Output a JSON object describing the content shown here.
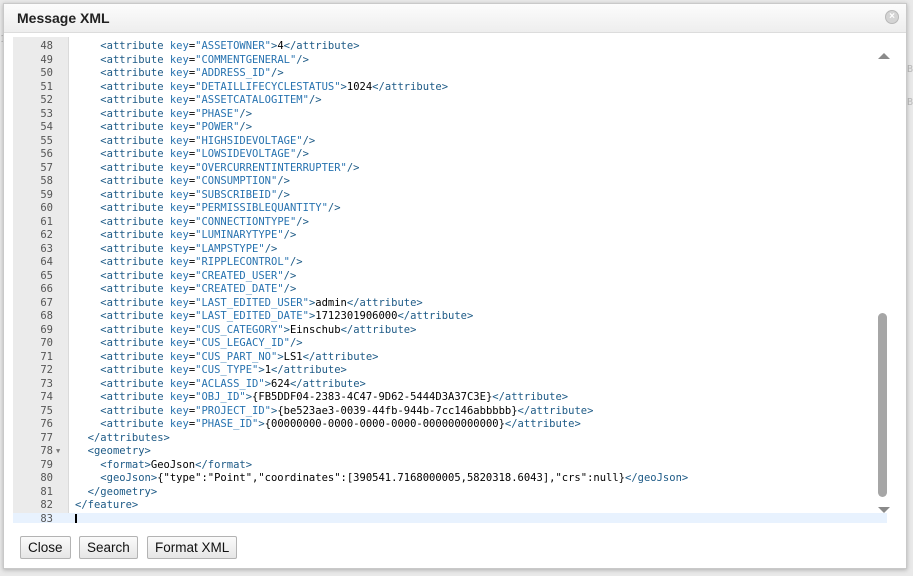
{
  "dialog": {
    "title": "Message XML",
    "close_glyph": "×",
    "close_icon": "close-icon"
  },
  "background": {
    "frag_left": "1",
    "frag_right_a": "Bl",
    "frag_right_b": "Bl"
  },
  "editor": {
    "lines": [
      {
        "n": "48",
        "indent": "    ",
        "key": "ASSETOWNER",
        "value": "4"
      },
      {
        "n": "49",
        "indent": "    ",
        "key": "COMMENTGENERAL"
      },
      {
        "n": "50",
        "indent": "    ",
        "key": "ADDRESS_ID"
      },
      {
        "n": "51",
        "indent": "    ",
        "key": "DETAILLIFECYCLESTATUS",
        "value": "1024"
      },
      {
        "n": "52",
        "indent": "    ",
        "key": "ASSETCATALOGITEM"
      },
      {
        "n": "53",
        "indent": "    ",
        "key": "PHASE"
      },
      {
        "n": "54",
        "indent": "    ",
        "key": "POWER"
      },
      {
        "n": "55",
        "indent": "    ",
        "key": "HIGHSIDEVOLTAGE"
      },
      {
        "n": "56",
        "indent": "    ",
        "key": "LOWSIDEVOLTAGE"
      },
      {
        "n": "57",
        "indent": "    ",
        "key": "OVERCURRENTINTERRUPTER"
      },
      {
        "n": "58",
        "indent": "    ",
        "key": "CONSUMPTION"
      },
      {
        "n": "59",
        "indent": "    ",
        "key": "SUBSCRIBEID"
      },
      {
        "n": "60",
        "indent": "    ",
        "key": "PERMISSIBLEQUANTITY"
      },
      {
        "n": "61",
        "indent": "    ",
        "key": "CONNECTIONTYPE"
      },
      {
        "n": "62",
        "indent": "    ",
        "key": "LUMINARYTYPE"
      },
      {
        "n": "63",
        "indent": "    ",
        "key": "LAMPSTYPE"
      },
      {
        "n": "64",
        "indent": "    ",
        "key": "RIPPLECONTROL"
      },
      {
        "n": "65",
        "indent": "    ",
        "key": "CREATED_USER"
      },
      {
        "n": "66",
        "indent": "    ",
        "key": "CREATED_DATE"
      },
      {
        "n": "67",
        "indent": "    ",
        "key": "LAST_EDITED_USER",
        "value": "admin"
      },
      {
        "n": "68",
        "indent": "    ",
        "key": "LAST_EDITED_DATE",
        "value": "1712301906000"
      },
      {
        "n": "69",
        "indent": "    ",
        "key": "CUS_CATEGORY",
        "value": "Einschub"
      },
      {
        "n": "70",
        "indent": "    ",
        "key": "CUS_LEGACY_ID"
      },
      {
        "n": "71",
        "indent": "    ",
        "key": "CUS_PART_NO",
        "value": "LS1"
      },
      {
        "n": "72",
        "indent": "    ",
        "key": "CUS_TYPE",
        "value": "1"
      },
      {
        "n": "73",
        "indent": "    ",
        "key": "ACLASS_ID",
        "value": "624"
      },
      {
        "n": "74",
        "indent": "    ",
        "key": "OBJ_ID",
        "value": "{FB5DDF04-2383-4C47-9D62-5444D3A37C3E}"
      },
      {
        "n": "75",
        "indent": "    ",
        "key": "PROJECT_ID",
        "value": "{be523ae3-0039-44fb-944b-7cc146abbbbb}"
      },
      {
        "n": "76",
        "indent": "    ",
        "key": "PHASE_ID",
        "value": "{00000000-0000-0000-0000-000000000000}"
      },
      {
        "n": "77",
        "indent": "  ",
        "raw_tag": "</attributes>"
      },
      {
        "n": "78",
        "indent": "  ",
        "raw_tag": "<geometry>",
        "fold": true
      },
      {
        "n": "79",
        "indent": "    ",
        "elem": "format",
        "value": "GeoJson"
      },
      {
        "n": "80",
        "indent": "    ",
        "elem": "geoJson",
        "value": "{\"type\":\"Point\",\"coordinates\":[390541.7168000005,5820318.6043],\"crs\":null}"
      },
      {
        "n": "81",
        "indent": "  ",
        "raw_tag": "</geometry>"
      },
      {
        "n": "82",
        "indent": "",
        "raw_tag": "</feature>"
      },
      {
        "n": "83",
        "indent": "",
        "active": true
      }
    ]
  },
  "buttons": {
    "close": "Close",
    "search": "Search",
    "format": "Format XML"
  }
}
